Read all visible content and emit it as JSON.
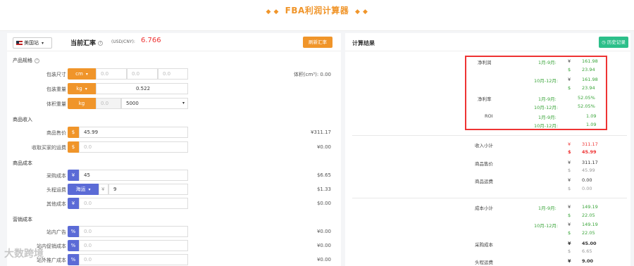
{
  "header": {
    "title": "FBA利润计算器"
  },
  "left": {
    "site": "美国站",
    "rate_title": "当前汇率",
    "rate_unit": "(USD/CNY):",
    "rate_value": "6.766",
    "refresh_btn": "刷新汇率",
    "spec_section": "产品规格",
    "pkg_size_label": "包装尺寸",
    "pkg_size_unit": "cm",
    "pkg_size_values": [
      "0.0",
      "0.0",
      "0.0"
    ],
    "volume_text": "体积(cm³): 0.00",
    "pkg_weight_label": "包装重量",
    "pkg_weight_unit": "kg",
    "pkg_weight_value": "0.522",
    "vol_weight_label": "体积重量",
    "vol_weight_unit": "kg",
    "vol_weight_value": "0.0",
    "vol_divisor": "5000",
    "income_section": "商品收入",
    "price_label": "商品售价",
    "price_unit": "$",
    "price_value": "45.99",
    "price_cny": "¥311.17",
    "shipping_income_label": "收取买家的运费",
    "shipping_income_unit": "$",
    "shipping_income_ph": "0.0",
    "shipping_income_cny": "¥0.00",
    "cost_section": "商品成本",
    "purchase_label": "采购成本",
    "purchase_unit": "¥",
    "purchase_value": "45",
    "purchase_usd": "$6.65",
    "freight_label": "头程运费",
    "freight_mode": "海运",
    "freight_unit": "¥",
    "freight_value": "9",
    "freight_usd": "$1.33",
    "other_label": "其他成本",
    "other_unit": "¥",
    "other_ph": "0.0",
    "other_usd": "$0.00",
    "marketing_section": "营销成本",
    "ad_label": "站内广告",
    "ad_unit": "%",
    "ad_ph": "0.0",
    "ad_cny": "¥0.00",
    "promo_label": "站内促销成本",
    "promo_unit": "%",
    "promo_ph": "0.0",
    "promo_cny": "¥0.00",
    "external_label": "站外推广成本",
    "external_unit": "%",
    "external_ph": "0.0",
    "external_cny": "¥0.00"
  },
  "right": {
    "title": "计算结果",
    "history_btn": "历史记录",
    "net_profit_label": "净利润",
    "m1_9": "1月-9月:",
    "m10_12": "10月-12月:",
    "np_19_cny": "161.98",
    "np_19_usd": "23.94",
    "np_1012_cny": "161.98",
    "np_1012_usd": "23.94",
    "margin_label": "净利率",
    "margin_19": "52.05%",
    "margin_1012": "52.05%",
    "roi_label": "ROI",
    "roi_19": "1.09",
    "roi_1012": "1.09",
    "income_subtotal_label": "收入小计",
    "income_subtotal_cny": "311.17",
    "income_subtotal_usd": "45.99",
    "sale_price_label": "商品售价",
    "sale_price_cny": "311.17",
    "sale_price_usd": "45.99",
    "product_shipping_label": "商品运费",
    "product_shipping_cny": "0.00",
    "product_shipping_usd": "0.00",
    "cost_subtotal_label": "成本小计",
    "cost_19_cny": "149.19",
    "cost_19_usd": "22.05",
    "cost_1012_cny": "149.19",
    "cost_1012_usd": "22.05",
    "purchase_cost_label": "采购成本",
    "purchase_cost_cny": "45.00",
    "purchase_cost_usd": "6.65",
    "head_freight_label": "头程运费",
    "head_freight_cny": "9.00",
    "yen": "¥",
    "dollar": "$"
  },
  "watermark": "大数跨境"
}
